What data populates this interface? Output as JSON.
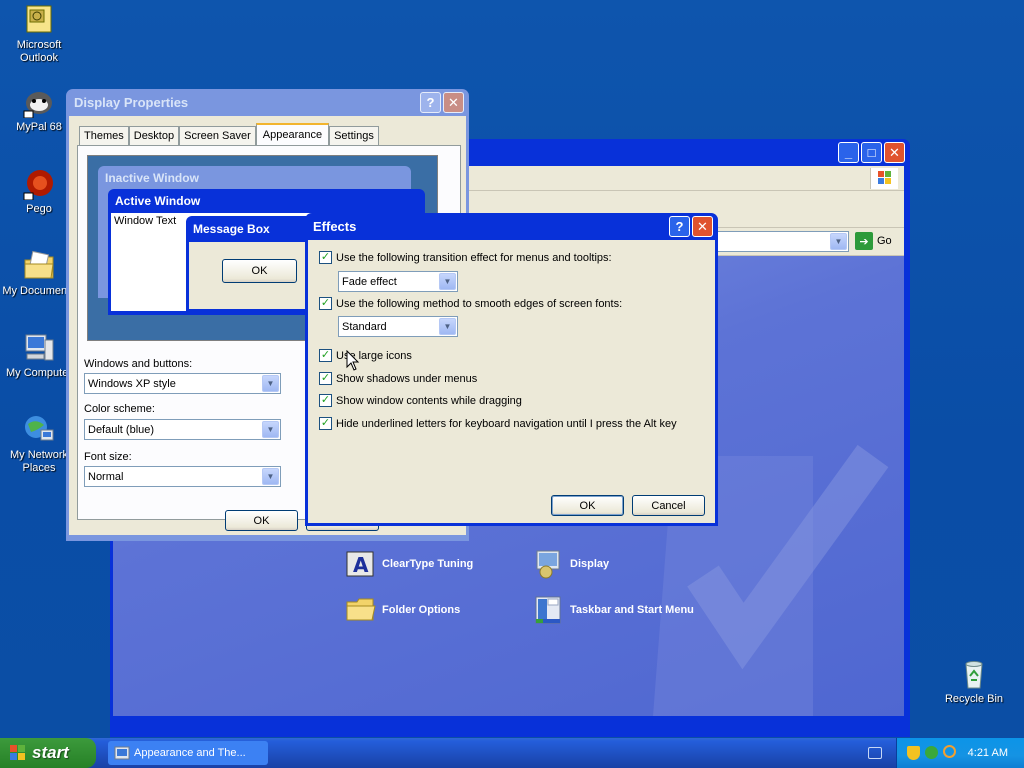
{
  "desktop_icons": [
    {
      "label": "Microsoft Outlook",
      "icon": "outlook-icon"
    },
    {
      "label": "MyPal 68",
      "icon": "mypal-icon"
    },
    {
      "label": "Pego",
      "icon": "pego-icon"
    },
    {
      "label": "My Documents",
      "icon": "my-documents-icon"
    },
    {
      "label": "My Computer",
      "icon": "my-computer-icon"
    },
    {
      "label": "My Network Places",
      "icon": "network-places-icon"
    },
    {
      "label": "Recycle Bin",
      "icon": "recycle-bin-icon"
    }
  ],
  "control_panel": {
    "go_label": "Go",
    "items": [
      {
        "label": "ClearType Tuning",
        "icon": "cleartype-icon"
      },
      {
        "label": "Display",
        "icon": "display-icon"
      },
      {
        "label": "Folder Options",
        "icon": "folder-options-icon"
      },
      {
        "label": "Taskbar and Start Menu",
        "icon": "taskbar-icon"
      }
    ]
  },
  "display_properties": {
    "title": "Display Properties",
    "tabs": [
      "Themes",
      "Desktop",
      "Screen Saver",
      "Appearance",
      "Settings"
    ],
    "active_tab": "Appearance",
    "preview": {
      "inactive_window": "Inactive Window",
      "active_window": "Active Window",
      "window_text": "Window Text",
      "message_box": "Message Box",
      "ok": "OK"
    },
    "windows_and_buttons_label": "Windows and buttons:",
    "windows_and_buttons_value": "Windows XP style",
    "color_scheme_label": "Color scheme:",
    "color_scheme_value": "Default (blue)",
    "font_size_label": "Font size:",
    "font_size_value": "Normal",
    "ok": "OK"
  },
  "effects": {
    "title": "Effects",
    "opt1": "Use the following transition effect for menus and tooltips:",
    "opt1_value": "Fade effect",
    "opt2": "Use the following method to smooth edges of screen fonts:",
    "opt2_value": "Standard",
    "opt3": "Use large icons",
    "opt4": "Show shadows under menus",
    "opt5": "Show window contents while dragging",
    "opt6": "Hide underlined letters for keyboard navigation until I press the Alt key",
    "ok": "OK",
    "cancel": "Cancel"
  },
  "taskbar": {
    "start": "start",
    "task": "Appearance and The...",
    "time": "4:21 AM"
  }
}
